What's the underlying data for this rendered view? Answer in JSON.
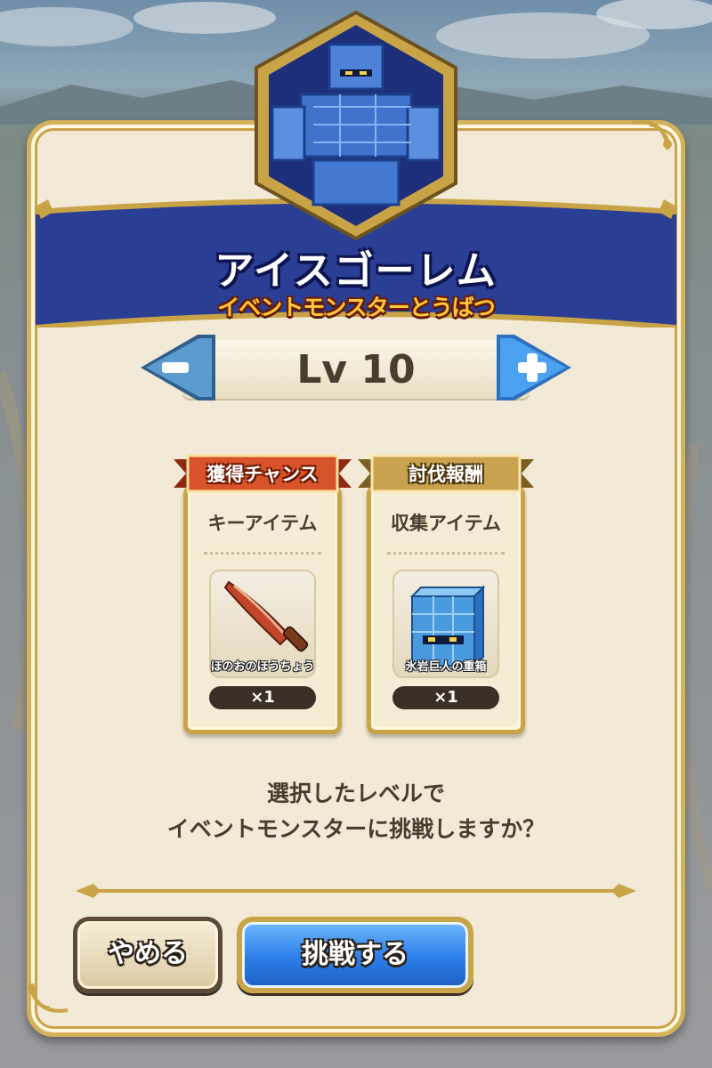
{
  "monster": {
    "name": "アイスゴーレム",
    "event_label": "イベントモンスターとうばつ"
  },
  "level": {
    "label": "Lv 10",
    "decrease_symbol": "−",
    "increase_symbol": "+"
  },
  "rewards": [
    {
      "ribbon": "獲得チャンス",
      "ribbon_color": "#d8532a",
      "title": "キーアイテム",
      "item_name": "ほのおのほうちょう",
      "item_icon": "flame-knife-icon",
      "count": "×1"
    },
    {
      "ribbon": "討伐報酬",
      "ribbon_color": "#b9943e",
      "title": "収集アイテム",
      "item_name": "氷岩巨人の重箱",
      "item_icon": "ice-block-box-icon",
      "count": "×1"
    }
  ],
  "prompt": {
    "line1": "選択したレベルで",
    "line2": "イベントモンスターに挑戦しますか？"
  },
  "buttons": {
    "cancel": "やめる",
    "challenge": "挑戦する"
  },
  "colors": {
    "banner_blue": "#2a3e94",
    "panel_bg": "#f2ead6",
    "gold_trim": "#c9a446",
    "challenge_blue": "#2c7de8"
  }
}
